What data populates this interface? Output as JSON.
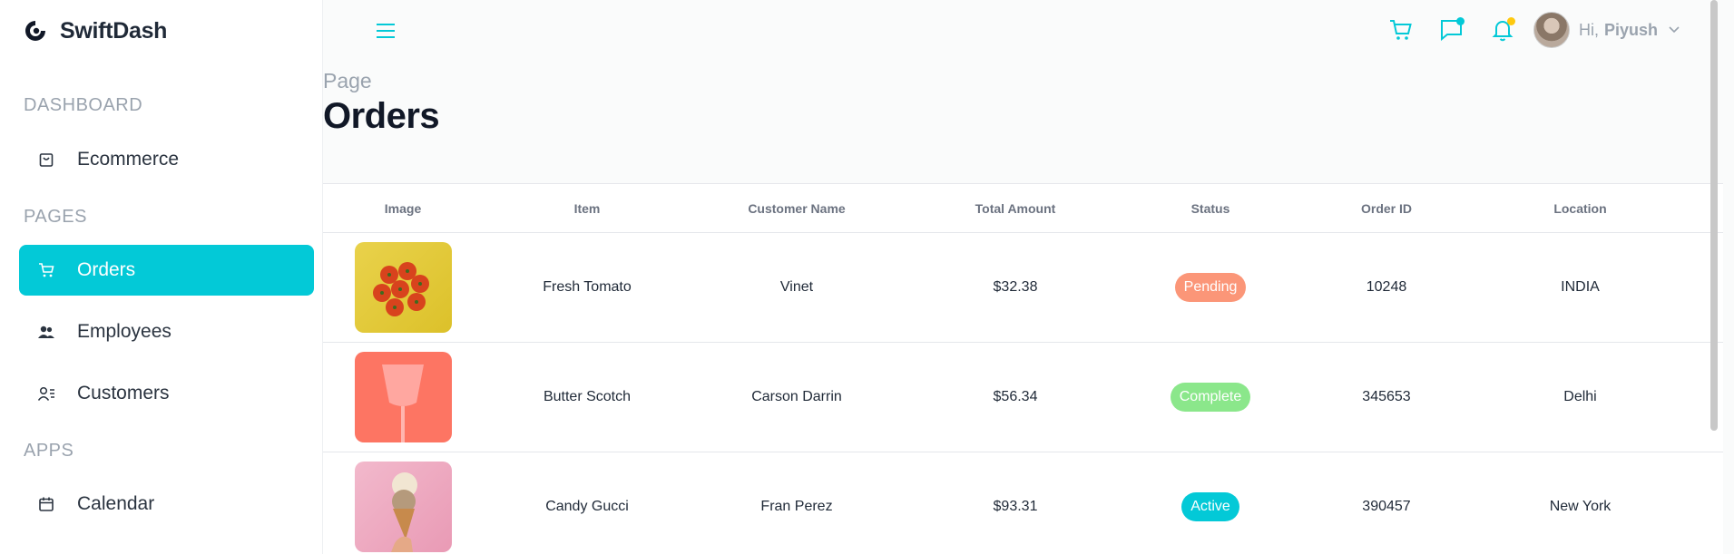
{
  "brand": {
    "name": "SwiftDash",
    "accent": "#03c9d7"
  },
  "sidebar": {
    "sections": [
      {
        "title": "DASHBOARD"
      },
      {
        "title": "PAGES"
      },
      {
        "title": "APPS"
      }
    ],
    "items": [
      {
        "label": "Ecommerce",
        "icon": "shopping-bag-icon",
        "active": false
      },
      {
        "label": "Orders",
        "icon": "cart-icon",
        "active": true
      },
      {
        "label": "Employees",
        "icon": "employees-icon",
        "active": false
      },
      {
        "label": "Customers",
        "icon": "customers-icon",
        "active": false
      },
      {
        "label": "Calendar",
        "icon": "calendar-icon",
        "active": false
      }
    ]
  },
  "topbar": {
    "greeting": "Hi,",
    "user_name": "Piyush",
    "icons": [
      "menu-icon",
      "cart-icon",
      "chat-icon",
      "bell-icon",
      "avatar",
      "chevron-down-icon"
    ],
    "dot_colors": {
      "chat": "#03c9d7",
      "bell": "#fec90f"
    }
  },
  "page": {
    "subtitle": "Page",
    "title": "Orders"
  },
  "table": {
    "headers": [
      "Image",
      "Item",
      "Customer Name",
      "Total Amount",
      "Status",
      "Order ID",
      "Location"
    ],
    "rows": [
      {
        "image": "tomatoes-image",
        "item": "Fresh Tomato",
        "customer": "Vinet",
        "amount": "$32.38",
        "status": "Pending",
        "status_color": "#fb9678",
        "order_id": "10248",
        "location": "INDIA"
      },
      {
        "image": "glass-image",
        "item": "Butter Scotch",
        "customer": "Carson Darrin",
        "amount": "$56.34",
        "status": "Complete",
        "status_color": "#8be78b",
        "order_id": "345653",
        "location": "Delhi"
      },
      {
        "image": "ice-cream-image",
        "item": "Candy Gucci",
        "customer": "Fran Perez",
        "amount": "$93.31",
        "status": "Active",
        "status_color": "#03c9d7",
        "order_id": "390457",
        "location": "New York"
      }
    ]
  }
}
